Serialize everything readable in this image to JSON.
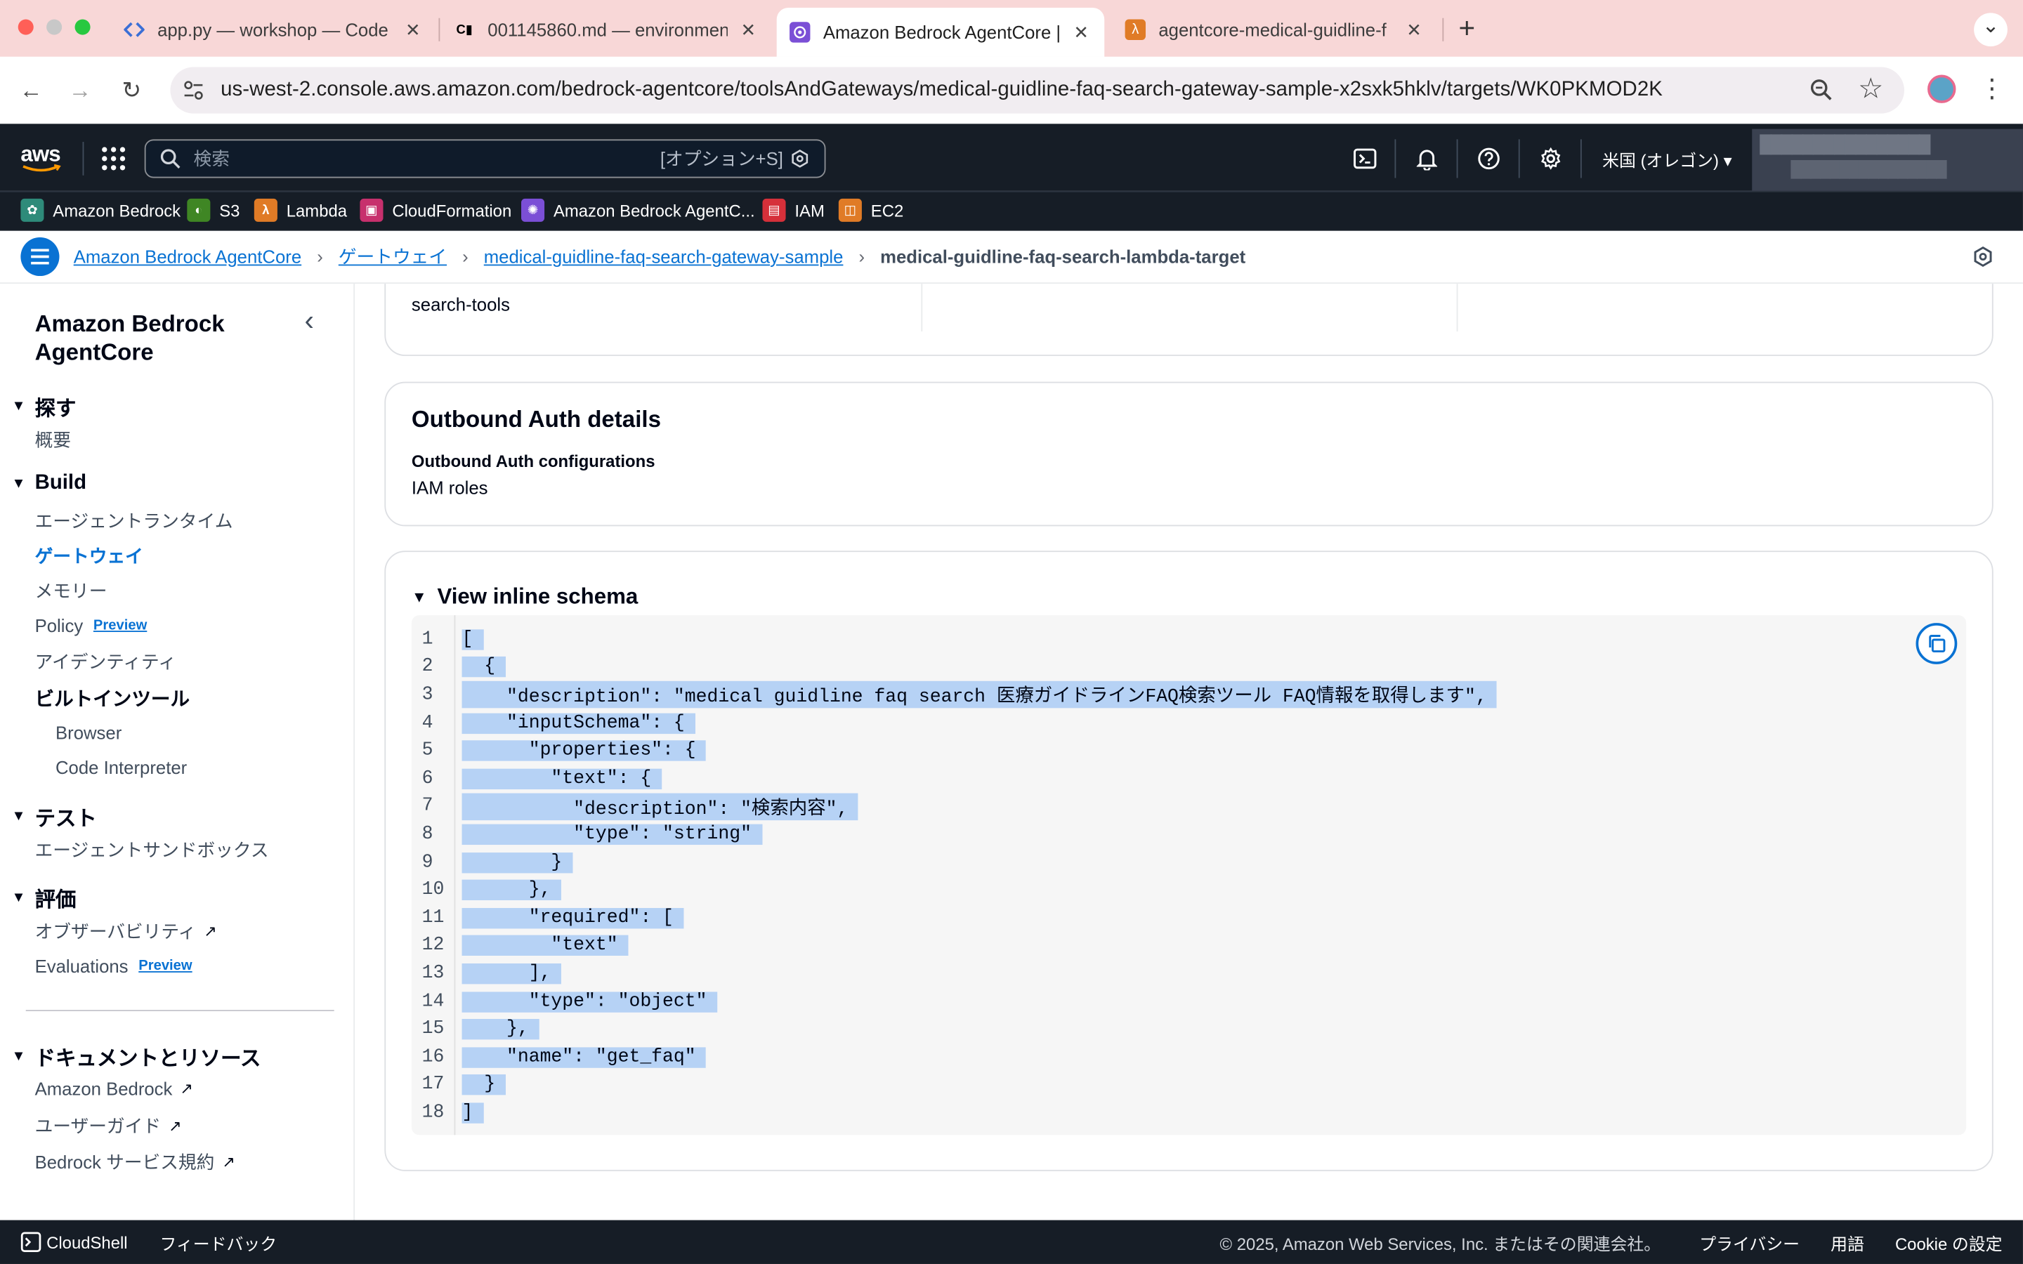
{
  "browser": {
    "tabs": [
      {
        "title": "app.py — workshop — Code E",
        "icon": "code-icon",
        "active": false
      },
      {
        "title": "001145860.md — environmen",
        "icon": "cm-icon",
        "active": false
      },
      {
        "title": "Amazon Bedrock AgentCore |",
        "icon": "bedrock-icon",
        "active": true
      },
      {
        "title": "agentcore-medical-guidline-f",
        "icon": "lambda-icon",
        "active": false
      }
    ],
    "new_tab_symbol": "+",
    "tab_close_symbol": "✕",
    "cm_glyph": "C▮",
    "url": "us-west-2.console.aws.amazon.com/bedrock-agentcore/toolsAndGateways/medical-guidline-faq-search-gateway-sample-x2sxk5hklv/targets/WK0PKMOD2K",
    "back_symbol": "←",
    "forward_symbol": "→",
    "reload_symbol": "↻",
    "menu_symbol": "⋮",
    "star_symbol": "☆",
    "collapse_symbol": "⌄"
  },
  "aws_header": {
    "logo": "aws",
    "search_placeholder": "検索",
    "search_shortcut": "[オプション+S]",
    "region": "米国 (オレゴン) ▾",
    "account_masked_1": "████████████████",
    "account_masked_2": "████████████████"
  },
  "favorites": [
    {
      "label": "Amazon Bedrock",
      "color": "#2e8b7a"
    },
    {
      "label": "S3",
      "color": "#3f8624"
    },
    {
      "label": "Lambda",
      "color": "#e07b26"
    },
    {
      "label": "CloudFormation",
      "color": "#c7306d"
    },
    {
      "label": "Amazon Bedrock AgentC...",
      "color": "#7b4fd6"
    },
    {
      "label": "IAM",
      "color": "#d6303a"
    },
    {
      "label": "EC2",
      "color": "#e07b26"
    }
  ],
  "breadcrumbs": {
    "items": [
      "Amazon Bedrock AgentCore",
      "ゲートウェイ",
      "medical-guidline-faq-search-gateway-sample"
    ],
    "current": "medical-guidline-faq-search-lambda-target",
    "separator": "›"
  },
  "sidebar": {
    "title": "Amazon Bedrock AgentCore",
    "collapse_symbol": "‹",
    "preview_label": "Preview",
    "sections": [
      {
        "label": "探す",
        "items": [
          "概要"
        ]
      },
      {
        "label": "Build",
        "items": [
          "エージェントランタイム",
          "ゲートウェイ",
          "メモリー",
          "Policy",
          "アイデンティティ"
        ]
      },
      {
        "label": "ビルトインツール",
        "items": [
          "Browser",
          "Code Interpreter"
        ]
      },
      {
        "label": "テスト",
        "items": [
          "エージェントサンドボックス"
        ]
      },
      {
        "label": "評価",
        "items": [
          "オブザーバビリティ",
          "Evaluations"
        ]
      },
      {
        "label": "ドキュメントとリソース",
        "items": [
          "Amazon Bedrock",
          "ユーザーガイド",
          "Bedrock サービス規約"
        ]
      }
    ],
    "external_symbol": "↗"
  },
  "main": {
    "top_card_text": "search-tools",
    "outbound": {
      "title": "Outbound Auth details",
      "label": "Outbound Auth configurations",
      "value": "IAM roles"
    },
    "schema": {
      "title": "View inline schema",
      "lines": [
        "[",
        "  {",
        "    \"description\": \"medical guidline faq search 医療ガイドラインFAQ検索ツール FAQ情報を取得します\",",
        "    \"inputSchema\": {",
        "      \"properties\": {",
        "        \"text\": {",
        "          \"description\": \"検索内容\",",
        "          \"type\": \"string\"",
        "        }",
        "      },",
        "      \"required\": [",
        "        \"text\"",
        "      ],",
        "      \"type\": \"object\"",
        "    },",
        "    \"name\": \"get_faq\"",
        "  }",
        "]"
      ]
    }
  },
  "footer": {
    "cloudshell": "CloudShell",
    "feedback": "フィードバック",
    "copyright": "© 2025, Amazon Web Services, Inc. またはその関連会社。",
    "privacy": "プライバシー",
    "terms": "用語",
    "cookie": "Cookie の設定"
  }
}
